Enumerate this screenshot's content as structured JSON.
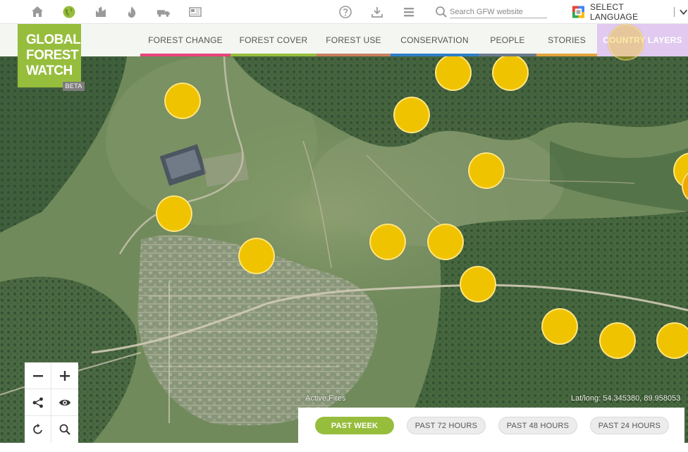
{
  "topbar": {
    "icons": [
      "home-icon",
      "globe-icon",
      "industry-icon",
      "fire-icon",
      "truck-icon",
      "newspaper-icon"
    ],
    "right_icons": [
      "help-icon",
      "download-icon",
      "menu-icon"
    ],
    "search": {
      "placeholder": "Search GFW website",
      "value": ""
    },
    "language": {
      "label": "SELECT LANGUAGE"
    }
  },
  "logo": {
    "lines": [
      "GLOBAL",
      "FOREST",
      "WATCH"
    ],
    "badge": "BETA"
  },
  "nav": {
    "tabs": [
      {
        "label": "FOREST CHANGE",
        "color": "#e8437c"
      },
      {
        "label": "FOREST COVER",
        "color": "#97bd3d"
      },
      {
        "label": "FOREST USE",
        "color": "#c77f5f"
      },
      {
        "label": "CONSERVATION",
        "color": "#2e7fc6"
      },
      {
        "label": "PEOPLE",
        "color": "#6b7b8c"
      },
      {
        "label": "STORIES",
        "color": "#e3a33b"
      },
      {
        "label": "COUNTRY LAYERS",
        "color": "#d7b8eb"
      }
    ]
  },
  "map": {
    "layer_label": "Active Fires",
    "coordinates": "Lat/long: 54.345380, 89.958053",
    "marker_color": "#f0c300",
    "fire_count": 17
  },
  "controls": {
    "zoom_out": "zoom-out",
    "zoom_in": "zoom-in",
    "share": "share",
    "toggle_view": "toggle-view",
    "reset": "reset",
    "search": "search"
  },
  "timeline": {
    "buttons": [
      {
        "label": "PAST WEEK",
        "active": true
      },
      {
        "label": "PAST 72 HOURS",
        "active": false
      },
      {
        "label": "PAST 48 HOURS",
        "active": false
      },
      {
        "label": "PAST 24 HOURS",
        "active": false
      }
    ],
    "active_color": "#97bd3d"
  }
}
